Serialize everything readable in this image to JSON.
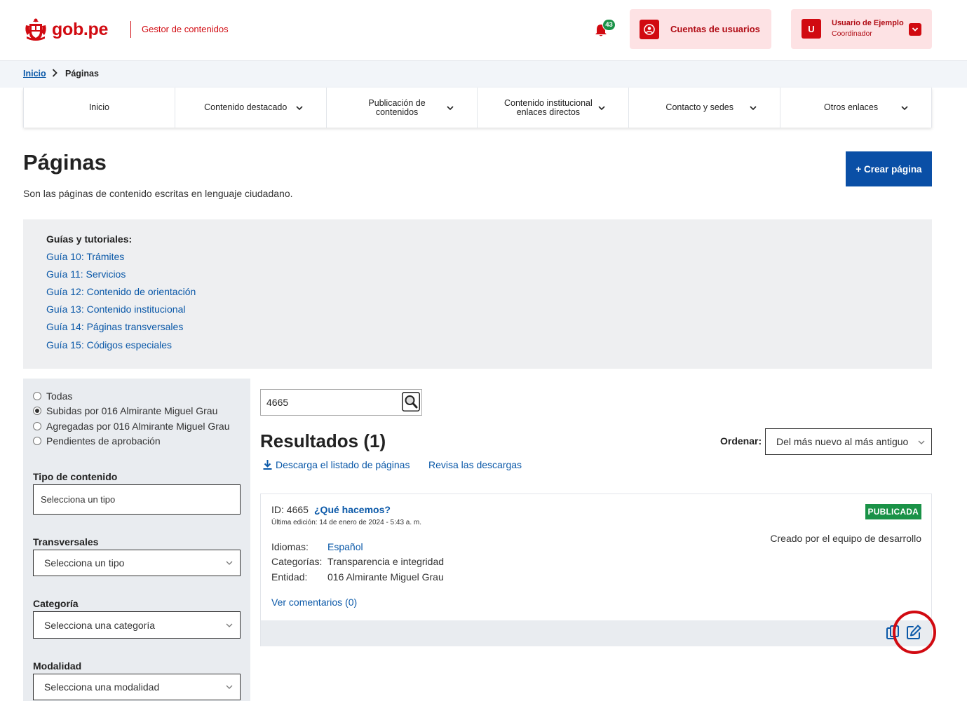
{
  "header": {
    "logo_text": "gob.pe",
    "subtitle": "Gestor de contenidos",
    "notifications_count": "43",
    "accounts_label": "Cuentas de usuarios",
    "user_initial": "U",
    "user_name": "Usuario de Ejemplo",
    "user_role": "Coordinador"
  },
  "breadcrumb": {
    "home": "Inicio",
    "current": "Páginas"
  },
  "nav": {
    "items": [
      {
        "label": "Inicio"
      },
      {
        "label": "Contenido destacado"
      },
      {
        "label": "Publicación de contenidos"
      },
      {
        "label": "Contenido institucional enlaces directos"
      },
      {
        "label": "Contacto y sedes"
      },
      {
        "label": "Otros enlaces"
      }
    ]
  },
  "page": {
    "title": "Páginas",
    "description": "Son las páginas de contenido escritas en lenguaje ciudadano.",
    "create_button": "+ Crear página"
  },
  "guides": {
    "title": "Guías y tutoriales:",
    "links": [
      "Guía 10: Trámites",
      "Guía 11: Servicios",
      "Guía 12: Contenido de orientación",
      "Guía 13: Contenido institucional",
      "Guía 14: Páginas transversales",
      "Guía 15: Códigos especiales"
    ]
  },
  "filters": {
    "options": [
      {
        "label": "Todas",
        "selected": false
      },
      {
        "label": "Subidas por 016 Almirante Miguel Grau",
        "selected": true
      },
      {
        "label": "Agregadas por 016 Almirante Miguel Grau",
        "selected": false
      },
      {
        "label": "Pendientes de aprobación",
        "selected": false
      }
    ],
    "content_type": {
      "label": "Tipo de contenido",
      "value": "Selecciona un tipo"
    },
    "transversal": {
      "label": "Transversales",
      "value": "Selecciona un tipo"
    },
    "category": {
      "label": "Categoría",
      "value": "Selecciona una categoría"
    },
    "modality": {
      "label": "Modalidad",
      "value": "Selecciona una modalidad"
    }
  },
  "search": {
    "value": "4665"
  },
  "results": {
    "title": "Resultados (1)",
    "order_label": "Ordenar:",
    "order_value": "Del más nuevo al más antiguo",
    "download_link": "Descarga el listado de páginas",
    "review_link": "Revisa las descargas"
  },
  "card": {
    "id_text": "ID: 4665",
    "title": "¿Qué hacemos?",
    "last_edit": "Última edición: 14 de enero de 2024 - 5:43 a. m.",
    "status": "PUBLICADA",
    "created_by": "Creado por el equipo de desarrollo",
    "languages_label": "Idiomas:",
    "languages_value": "Español",
    "categories_label": "Categorías:",
    "categories_value": "Transparencia e integridad",
    "entity_label": "Entidad:",
    "entity_value": "016 Almirante Miguel Grau",
    "comments_link": "Ver comentarios (0)"
  },
  "colors": {
    "brand_red": "#d10a11",
    "link_blue": "#0a58a8",
    "primary_button": "#0a4fa6",
    "status_green": "#1a9247"
  }
}
